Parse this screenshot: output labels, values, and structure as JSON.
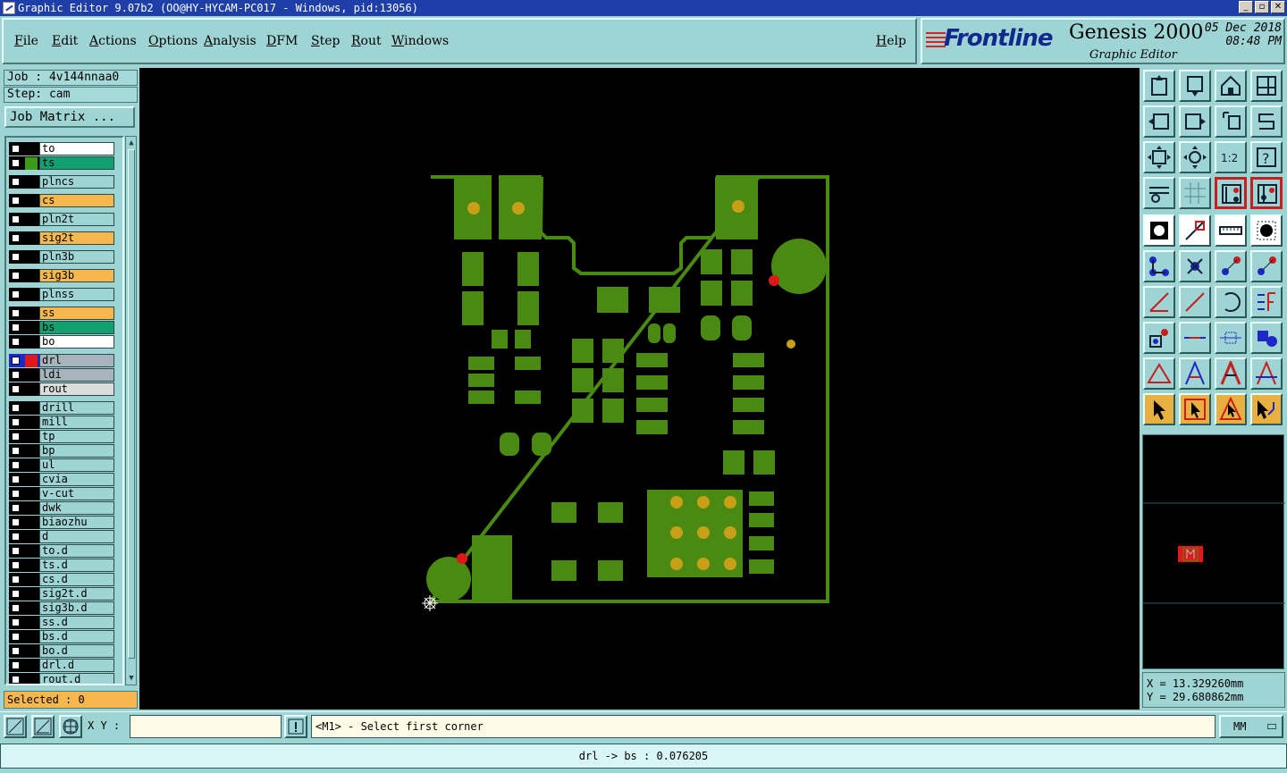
{
  "window": {
    "title": "Graphic Editor 9.07b2 (OO@HY-HYCAM-PC017 - Windows, pid:13056)",
    "controls": [
      "_",
      "▫",
      "✕"
    ]
  },
  "menu": [
    "File",
    "Edit",
    "Actions",
    "Options",
    "Analysis",
    "DFM",
    "Step",
    "Rout",
    "Windows"
  ],
  "help_label": "Help",
  "brand": {
    "logo": "Frontline",
    "product": "Genesis 2000",
    "sub": "Graphic Editor",
    "date": "05 Dec 2018",
    "time": "08:48 PM"
  },
  "job": {
    "job_label": "Job : 4v144nnaa0",
    "step_label": "Step: cam",
    "matrix_button": "Job Matrix ..."
  },
  "layers": [
    {
      "name": "to",
      "color": "#ffffff",
      "swatch": ""
    },
    {
      "name": "ts",
      "color": "#12a070",
      "swatch": "#3c9a18"
    },
    {
      "name": "plncs",
      "color": "#9ed4d4",
      "swatch": ""
    },
    {
      "name": "cs",
      "color": "#f6b84c",
      "swatch": ""
    },
    {
      "name": "pln2t",
      "color": "#9ed4d4",
      "swatch": ""
    },
    {
      "name": "sig2t",
      "color": "#f6b84c",
      "swatch": ""
    },
    {
      "name": "pln3b",
      "color": "#9ed4d4",
      "swatch": ""
    },
    {
      "name": "sig3b",
      "color": "#f6b84c",
      "swatch": ""
    },
    {
      "name": "plnss",
      "color": "#9ed4d4",
      "swatch": ""
    },
    {
      "name": "ss",
      "color": "#f6b84c",
      "swatch": ""
    },
    {
      "name": "bs",
      "color": "#12a070",
      "swatch": ""
    },
    {
      "name": "bo",
      "color": "#ffffff",
      "swatch": ""
    },
    {
      "name": "drl",
      "color": "#a8b4bc",
      "swatch": "#e01818",
      "active": true
    },
    {
      "name": "ldi",
      "color": "#a8b4bc",
      "swatch": ""
    },
    {
      "name": "rout",
      "color": "#dcdcdc",
      "swatch": ""
    },
    {
      "name": "drill",
      "color": "#9ed4d4",
      "swatch": ""
    },
    {
      "name": "mill",
      "color": "#9ed4d4",
      "swatch": ""
    },
    {
      "name": "tp",
      "color": "#9ed4d4",
      "swatch": ""
    },
    {
      "name": "bp",
      "color": "#9ed4d4",
      "swatch": ""
    },
    {
      "name": "ul",
      "color": "#9ed4d4",
      "swatch": ""
    },
    {
      "name": "cvia",
      "color": "#9ed4d4",
      "swatch": ""
    },
    {
      "name": "v-cut",
      "color": "#9ed4d4",
      "swatch": ""
    },
    {
      "name": "dwk",
      "color": "#9ed4d4",
      "swatch": ""
    },
    {
      "name": "biaozhu",
      "color": "#9ed4d4",
      "swatch": ""
    },
    {
      "name": "d",
      "color": "#9ed4d4",
      "swatch": ""
    },
    {
      "name": "to.d",
      "color": "#9ed4d4",
      "swatch": ""
    },
    {
      "name": "ts.d",
      "color": "#9ed4d4",
      "swatch": ""
    },
    {
      "name": "cs.d",
      "color": "#9ed4d4",
      "swatch": ""
    },
    {
      "name": "sig2t.d",
      "color": "#9ed4d4",
      "swatch": ""
    },
    {
      "name": "sig3b.d",
      "color": "#9ed4d4",
      "swatch": ""
    },
    {
      "name": "ss.d",
      "color": "#9ed4d4",
      "swatch": ""
    },
    {
      "name": "bs.d",
      "color": "#9ed4d4",
      "swatch": ""
    },
    {
      "name": "bo.d",
      "color": "#9ed4d4",
      "swatch": ""
    },
    {
      "name": "drl.d",
      "color": "#9ed4d4",
      "swatch": ""
    },
    {
      "name": "rout.d",
      "color": "#9ed4d4",
      "swatch": ""
    }
  ],
  "selected_label": "Selected : 0",
  "coords": {
    "x": "X = 13.329260mm",
    "y": "Y = 29.680862mm"
  },
  "xy_label": "X Y :",
  "xy_value": "",
  "prompt": "<M1> - Select first corner",
  "units": "MM",
  "status": "drl -> bs : 0.076205",
  "colors": {
    "copper": "#4b8a12",
    "drill": "#c8a018",
    "selected_drill": "#e01818",
    "panel": "#9ed4d4"
  }
}
